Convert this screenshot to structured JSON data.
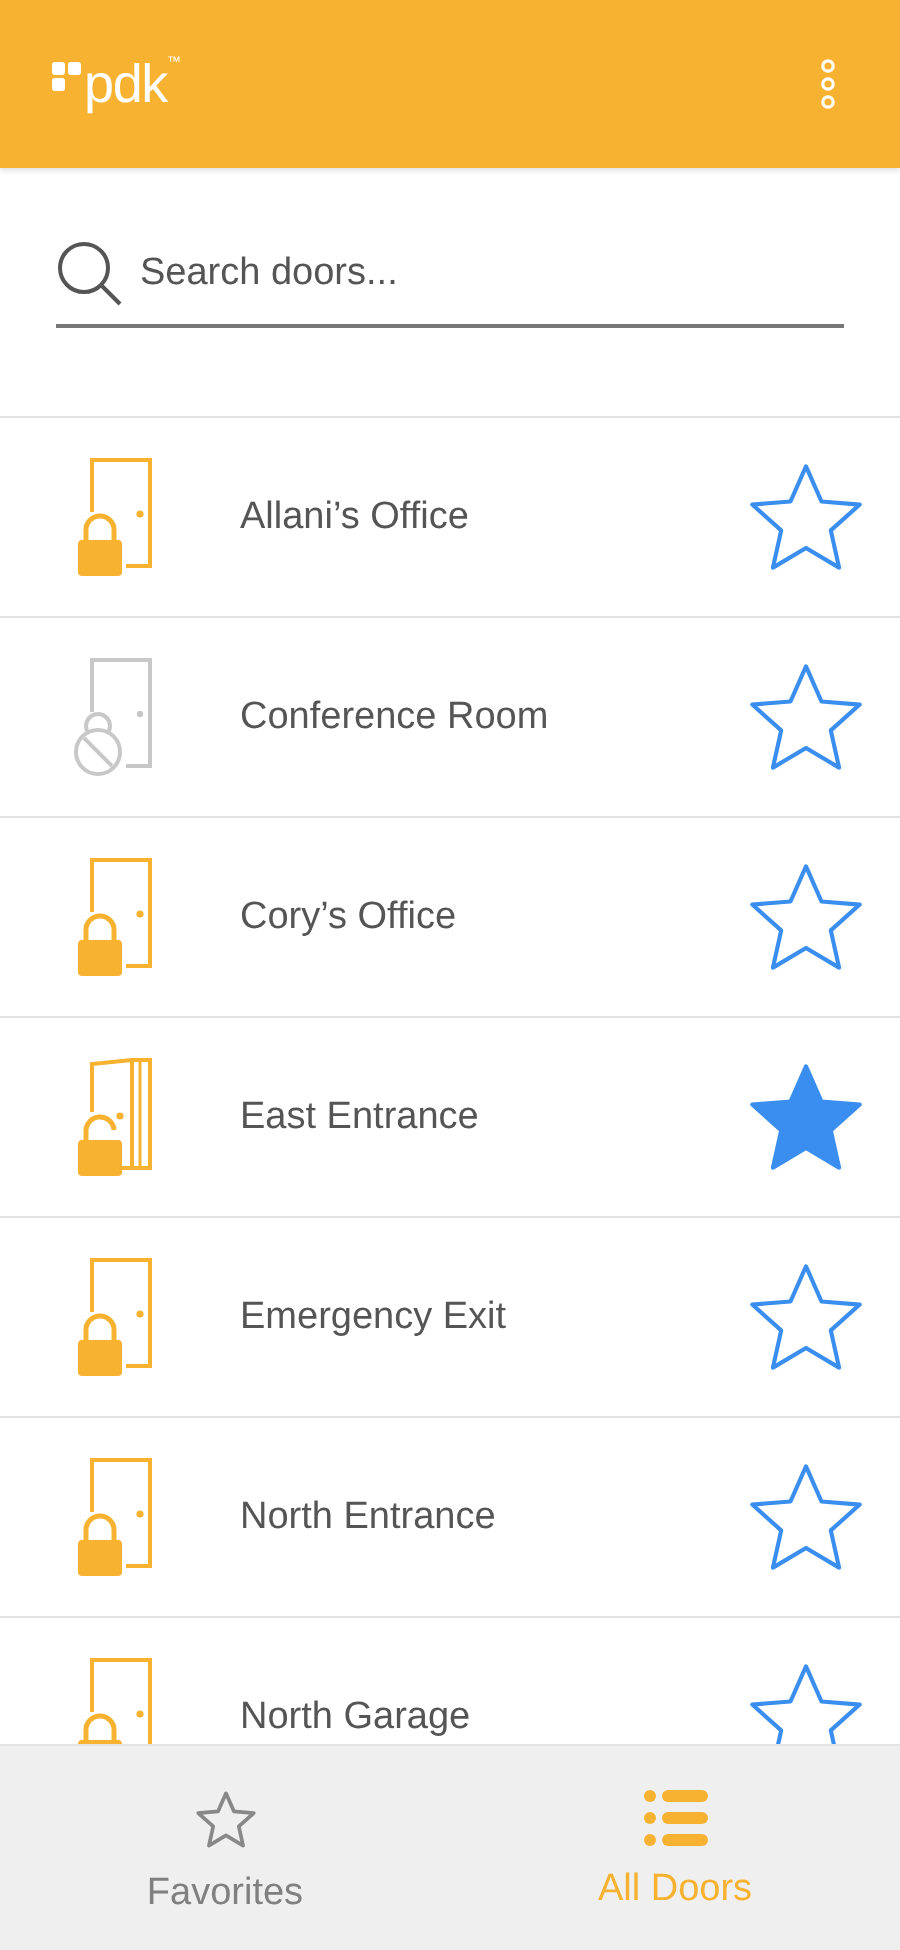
{
  "header": {
    "logo": "pdk",
    "trademark": "™"
  },
  "search": {
    "placeholder": "Search doors..."
  },
  "doors": [
    {
      "name": "Allani’s Office",
      "kind": "locked",
      "favorite": false
    },
    {
      "name": "Conference Room",
      "kind": "disabled",
      "favorite": false
    },
    {
      "name": "Cory’s Office",
      "kind": "locked",
      "favorite": false
    },
    {
      "name": "East Entrance",
      "kind": "unlocked",
      "favorite": true
    },
    {
      "name": "Emergency Exit",
      "kind": "locked",
      "favorite": false
    },
    {
      "name": "North Entrance",
      "kind": "locked",
      "favorite": false
    },
    {
      "name": "North Garage",
      "kind": "locked",
      "favorite": false
    }
  ],
  "tabs": [
    {
      "label": "Favorites",
      "kind": "star",
      "selected": false
    },
    {
      "label": "All Doors",
      "kind": "list",
      "selected": true
    }
  ]
}
